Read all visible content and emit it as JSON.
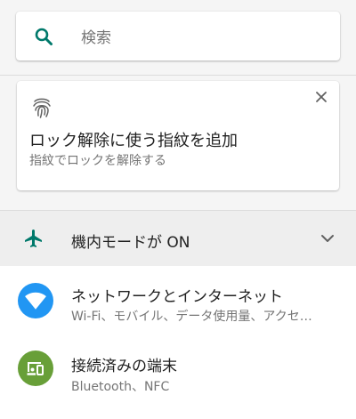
{
  "search": {
    "placeholder": "検索",
    "icon": "search-icon"
  },
  "suggestion_card": {
    "icon": "fingerprint-icon",
    "title": "ロック解除に使う指紋を追加",
    "summary": "指紋でロックを解除する",
    "dismiss_icon": "close-icon"
  },
  "condition": {
    "icon": "airplane-icon",
    "label": "機内モードが ON",
    "expand_icon": "chevron-down-icon"
  },
  "settings": [
    {
      "title": "ネットワークとインターネット",
      "summary": "Wi-Fi、モバイル、データ使用量、アクセ…",
      "icon": "wifi-icon",
      "icon_color": "#2196F3"
    },
    {
      "title": "接続済みの端末",
      "summary": "Bluetooth、NFC",
      "icon": "devices-icon",
      "icon_color": "#689F38"
    }
  ],
  "colors": {
    "accent": "#00796B",
    "background": "#f5f5f5"
  }
}
